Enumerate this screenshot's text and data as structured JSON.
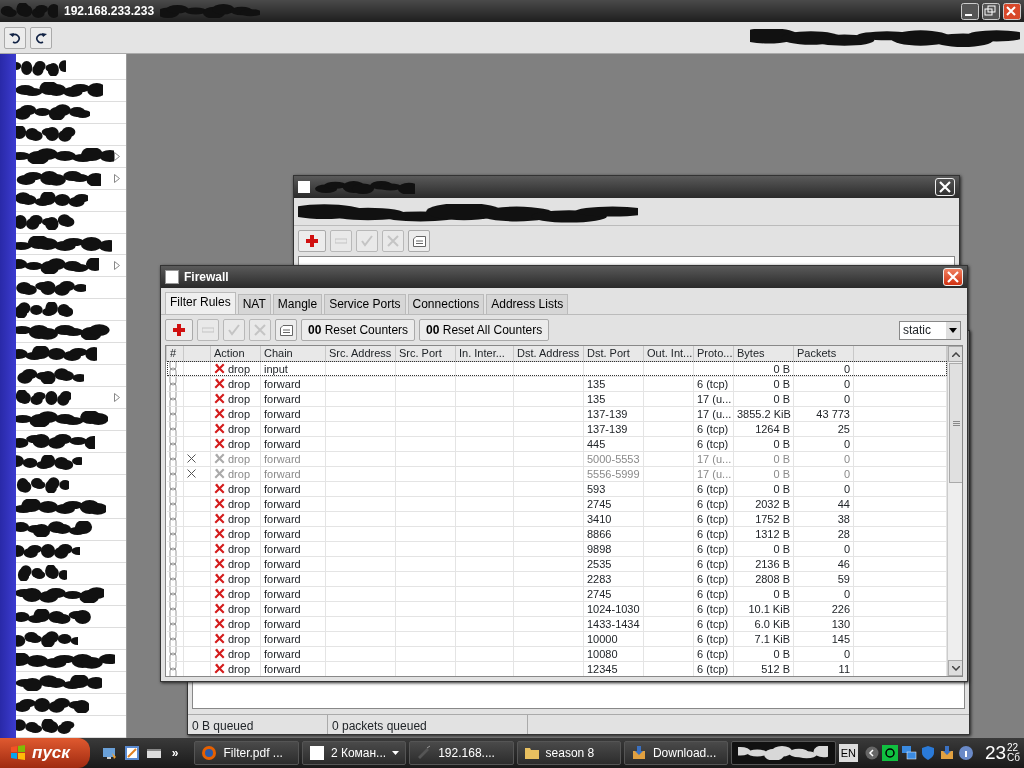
{
  "app": {
    "title": "192.168.233.233"
  },
  "sidebar": {
    "items": [
      {
        "submenu": false
      },
      {
        "submenu": false
      },
      {
        "submenu": false
      },
      {
        "submenu": false
      },
      {
        "submenu": true
      },
      {
        "submenu": true
      },
      {
        "submenu": false
      },
      {
        "submenu": false
      },
      {
        "submenu": false
      },
      {
        "submenu": true
      },
      {
        "submenu": false
      },
      {
        "submenu": false
      },
      {
        "submenu": false
      },
      {
        "submenu": false
      },
      {
        "submenu": false
      },
      {
        "submenu": true
      },
      {
        "submenu": false
      },
      {
        "submenu": false
      },
      {
        "submenu": false
      },
      {
        "submenu": false
      },
      {
        "submenu": false
      },
      {
        "submenu": false
      },
      {
        "submenu": false
      },
      {
        "submenu": false
      },
      {
        "submenu": false
      },
      {
        "submenu": false
      },
      {
        "submenu": false
      },
      {
        "submenu": false
      },
      {
        "submenu": false
      },
      {
        "submenu": false
      },
      {
        "submenu": false
      }
    ]
  },
  "back_window": {
    "toolbar": [
      {
        "kind": "add",
        "disabled": false
      },
      {
        "kind": "remove",
        "disabled": true
      },
      {
        "kind": "enable",
        "disabled": true
      },
      {
        "kind": "disable",
        "disabled": true
      },
      {
        "kind": "comment",
        "disabled": false
      }
    ]
  },
  "queue_window": {
    "status_bar": [
      "0 B queued",
      "0 packets queued"
    ]
  },
  "firewall": {
    "title": "Firewall",
    "tabs": [
      {
        "label": "Filter Rules",
        "selected": true
      },
      {
        "label": "NAT",
        "selected": false
      },
      {
        "label": "Mangle",
        "selected": false
      },
      {
        "label": "Service Ports",
        "selected": false
      },
      {
        "label": "Connections",
        "selected": false
      },
      {
        "label": "Address Lists",
        "selected": false
      }
    ],
    "toolbar": [
      {
        "kind": "add",
        "disabled": false
      },
      {
        "kind": "remove",
        "disabled": true
      },
      {
        "kind": "enable",
        "disabled": true
      },
      {
        "kind": "disable",
        "disabled": true
      },
      {
        "kind": "comment",
        "disabled": false
      }
    ],
    "counter_buttons": [
      "**00** Reset Counters",
      "**00** Reset All Counters"
    ],
    "filter": {
      "value": "static"
    },
    "table": {
      "columns": [
        "#",
        "Action",
        "Chain",
        "Src. Address",
        "Src. Port",
        "In. Inter...",
        "Dst. Address",
        "Dst. Port",
        "Out. Int...",
        "Proto...",
        "Bytes",
        "Packets"
      ],
      "rows": [
        {
          "selected": true,
          "disabled": false,
          "action": "drop",
          "chain": "input",
          "bytes": "0 B",
          "packets": "0"
        },
        {
          "selected": false,
          "disabled": false,
          "action": "drop",
          "chain": "forward",
          "dst_port": "135",
          "protocol": "6 (tcp)",
          "bytes": "0 B",
          "packets": "0"
        },
        {
          "selected": false,
          "disabled": false,
          "action": "drop",
          "chain": "forward",
          "dst_port": "135",
          "protocol": "17 (u...",
          "bytes": "0 B",
          "packets": "0"
        },
        {
          "selected": false,
          "disabled": false,
          "action": "drop",
          "chain": "forward",
          "dst_port": "137-139",
          "protocol": "17 (u...",
          "bytes": "3855.2 KiB",
          "packets": "43 773"
        },
        {
          "selected": false,
          "disabled": false,
          "action": "drop",
          "chain": "forward",
          "dst_port": "137-139",
          "protocol": "6 (tcp)",
          "bytes": "1264 B",
          "packets": "25"
        },
        {
          "selected": false,
          "disabled": false,
          "action": "drop",
          "chain": "forward",
          "dst_port": "445",
          "protocol": "6 (tcp)",
          "bytes": "0 B",
          "packets": "0"
        },
        {
          "selected": false,
          "disabled": true,
          "action": "drop",
          "chain": "forward",
          "dst_port": "5000-5553",
          "protocol": "17 (u...",
          "bytes": "0 B",
          "packets": "0"
        },
        {
          "selected": false,
          "disabled": true,
          "action": "drop",
          "chain": "forward",
          "dst_port": "5556-5999",
          "protocol": "17 (u...",
          "bytes": "0 B",
          "packets": "0"
        },
        {
          "selected": false,
          "disabled": false,
          "action": "drop",
          "chain": "forward",
          "dst_port": "593",
          "protocol": "6 (tcp)",
          "bytes": "0 B",
          "packets": "0"
        },
        {
          "selected": false,
          "disabled": false,
          "action": "drop",
          "chain": "forward",
          "dst_port": "2745",
          "protocol": "6 (tcp)",
          "bytes": "2032 B",
          "packets": "44"
        },
        {
          "selected": false,
          "disabled": false,
          "action": "drop",
          "chain": "forward",
          "dst_port": "3410",
          "protocol": "6 (tcp)",
          "bytes": "1752 B",
          "packets": "38"
        },
        {
          "selected": false,
          "disabled": false,
          "action": "drop",
          "chain": "forward",
          "dst_port": "8866",
          "protocol": "6 (tcp)",
          "bytes": "1312 B",
          "packets": "28"
        },
        {
          "selected": false,
          "disabled": false,
          "action": "drop",
          "chain": "forward",
          "dst_port": "9898",
          "protocol": "6 (tcp)",
          "bytes": "0 B",
          "packets": "0"
        },
        {
          "selected": false,
          "disabled": false,
          "action": "drop",
          "chain": "forward",
          "dst_port": "2535",
          "protocol": "6 (tcp)",
          "bytes": "2136 B",
          "packets": "46"
        },
        {
          "selected": false,
          "disabled": false,
          "action": "drop",
          "chain": "forward",
          "dst_port": "2283",
          "protocol": "6 (tcp)",
          "bytes": "2808 B",
          "packets": "59"
        },
        {
          "selected": false,
          "disabled": false,
          "action": "drop",
          "chain": "forward",
          "dst_port": "2745",
          "protocol": "6 (tcp)",
          "bytes": "0 B",
          "packets": "0"
        },
        {
          "selected": false,
          "disabled": false,
          "action": "drop",
          "chain": "forward",
          "dst_port": "1024-1030",
          "protocol": "6 (tcp)",
          "bytes": "10.1 KiB",
          "packets": "226"
        },
        {
          "selected": false,
          "disabled": false,
          "action": "drop",
          "chain": "forward",
          "dst_port": "1433-1434",
          "protocol": "6 (tcp)",
          "bytes": "6.0 KiB",
          "packets": "130"
        },
        {
          "selected": false,
          "disabled": false,
          "action": "drop",
          "chain": "forward",
          "dst_port": "10000",
          "protocol": "6 (tcp)",
          "bytes": "7.1 KiB",
          "packets": "145"
        },
        {
          "selected": false,
          "disabled": false,
          "action": "drop",
          "chain": "forward",
          "dst_port": "10080",
          "protocol": "6 (tcp)",
          "bytes": "0 B",
          "packets": "0"
        },
        {
          "selected": false,
          "disabled": false,
          "action": "drop",
          "chain": "forward",
          "dst_port": "12345",
          "protocol": "6 (tcp)",
          "bytes": "512 B",
          "packets": "11"
        }
      ]
    }
  },
  "taskbar": {
    "start": "пуск",
    "more": "»",
    "tasks": [
      {
        "kind": "browser",
        "label": "Filter.pdf ..."
      },
      {
        "kind": "group",
        "label": "2 Коман..."
      },
      {
        "kind": "terminal",
        "label": "192.168...."
      },
      {
        "kind": "folder",
        "label": "season 8"
      },
      {
        "kind": "download",
        "label": "Download..."
      },
      {
        "kind": "redacted"
      }
    ],
    "language": "EN",
    "clock": {
      "hour": "23",
      "minute": "22",
      "day": "Сб"
    }
  }
}
